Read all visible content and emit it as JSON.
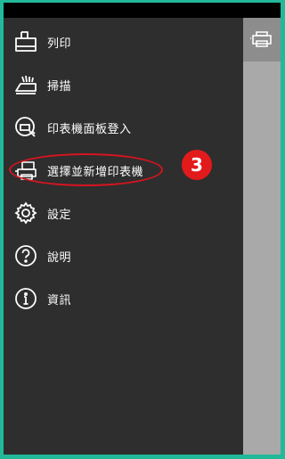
{
  "menu": {
    "items": [
      {
        "label": "列印",
        "icon": "print-icon"
      },
      {
        "label": "掃描",
        "icon": "scan-icon"
      },
      {
        "label": "印表機面板登入",
        "icon": "panel-login-icon"
      },
      {
        "label": "選擇並新增印表機",
        "icon": "select-printer-icon"
      },
      {
        "label": "設定",
        "icon": "gear-icon"
      },
      {
        "label": "說明",
        "icon": "help-icon"
      },
      {
        "label": "資訊",
        "icon": "info-icon"
      }
    ]
  },
  "annotation": {
    "step": "3",
    "color": "#e21a1c"
  },
  "colors": {
    "drawer": "#2e2e2e",
    "border": "#22b89a",
    "highlight": "#d7141f"
  }
}
